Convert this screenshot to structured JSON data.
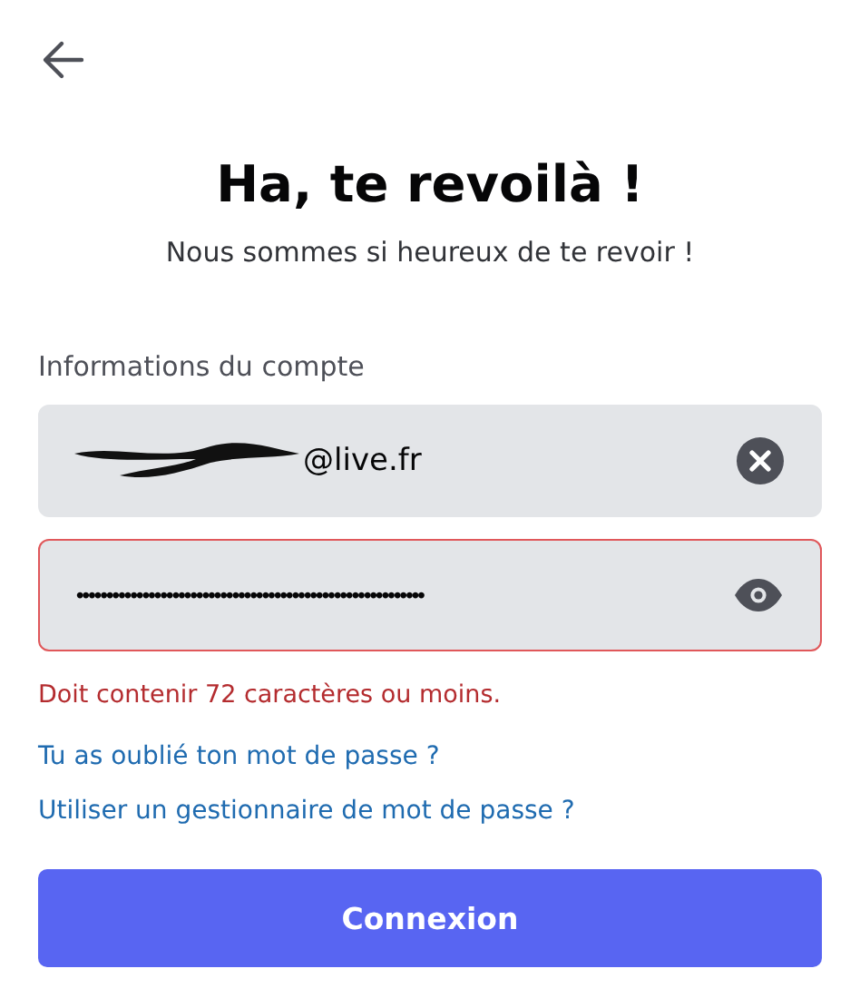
{
  "title": "Ha, te revoilà !",
  "subtitle": "Nous sommes si heureux de te revoir !",
  "section_label": "Informations du compte",
  "fields": [
    {
      "kind": "email",
      "value": "@live.fr",
      "redacted": true,
      "invalid": false
    },
    {
      "kind": "password",
      "value": "••••••••••••••••••••••••••••••••••••••••••••••••••••••••••",
      "redacted": false,
      "invalid": true
    }
  ],
  "error": "Doit contenir 72 caractères ou moins.",
  "links": [
    "Tu as oublié ton mot de passe ?",
    "Utiliser un gestionnaire de mot de passe ?"
  ],
  "button": "Connexion"
}
